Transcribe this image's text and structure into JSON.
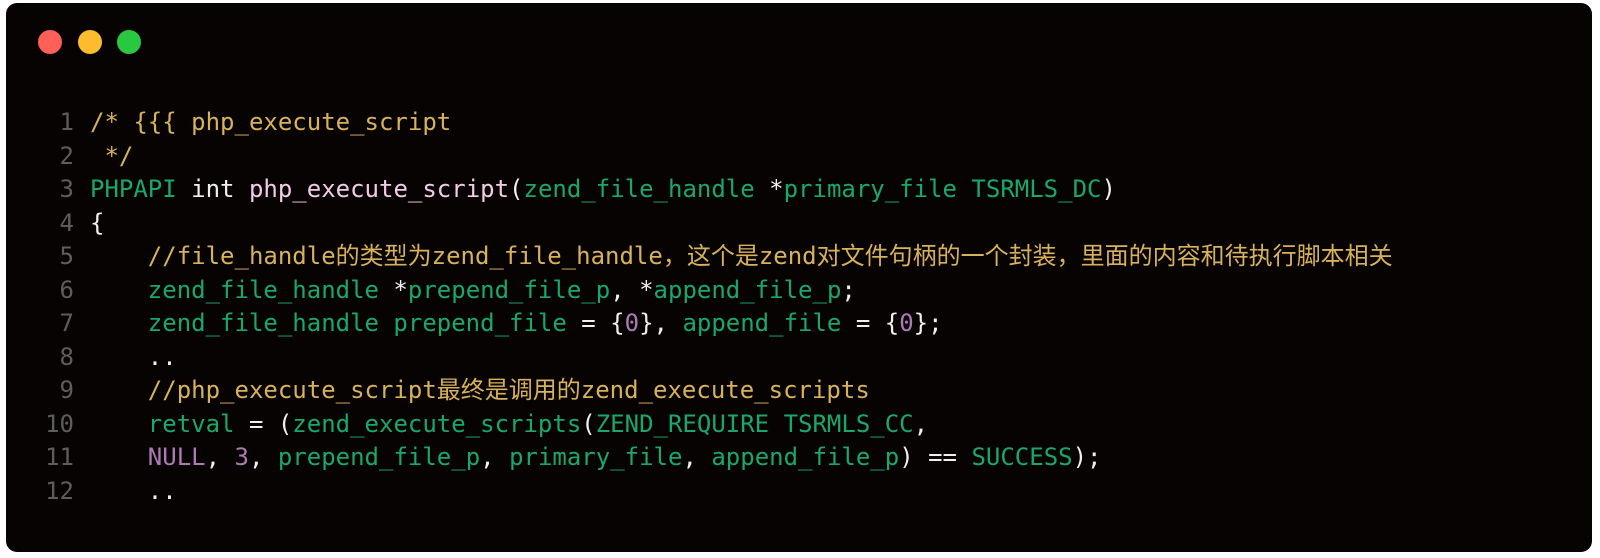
{
  "window": {
    "controls": {
      "close_color": "#fe5f57",
      "minimize_color": "#fdbc2e",
      "maximize_color": "#28c840"
    }
  },
  "colors": {
    "background": "#070303",
    "comment": "#d8b25a",
    "type": "#1aa86a",
    "plain": "#f0f0f0",
    "function": "#f2cbe6",
    "number": "#ad7ab6",
    "line_number": "#5d5d5d"
  },
  "code": {
    "lines": [
      {
        "n": "1",
        "tokens": [
          {
            "c": "comment",
            "t": "/* {{{ php_execute_script"
          }
        ]
      },
      {
        "n": "2",
        "tokens": [
          {
            "c": "comment",
            "t": " */"
          }
        ]
      },
      {
        "n": "3",
        "tokens": [
          {
            "c": "type",
            "t": "PHPAPI"
          },
          {
            "c": "plain",
            "t": " int "
          },
          {
            "c": "func",
            "t": "php_execute_script"
          },
          {
            "c": "plain",
            "t": "("
          },
          {
            "c": "type",
            "t": "zend_file_handle"
          },
          {
            "c": "plain",
            "t": " *"
          },
          {
            "c": "type",
            "t": "primary_file TSRMLS_DC"
          },
          {
            "c": "plain",
            "t": ")"
          }
        ]
      },
      {
        "n": "4",
        "tokens": [
          {
            "c": "plain",
            "t": "{"
          }
        ]
      },
      {
        "n": "5",
        "tokens": [
          {
            "c": "comment",
            "t": "    //file_handle的类型为zend_file_handle，这个是zend对文件句柄的一个封装，里面的内容和待执行脚本相关"
          }
        ]
      },
      {
        "n": "6",
        "tokens": [
          {
            "c": "plain",
            "t": "    "
          },
          {
            "c": "type",
            "t": "zend_file_handle"
          },
          {
            "c": "plain",
            "t": " *"
          },
          {
            "c": "type",
            "t": "prepend_file_p"
          },
          {
            "c": "plain",
            "t": ", *"
          },
          {
            "c": "type",
            "t": "append_file_p"
          },
          {
            "c": "plain",
            "t": ";"
          }
        ]
      },
      {
        "n": "7",
        "tokens": [
          {
            "c": "plain",
            "t": "    "
          },
          {
            "c": "type",
            "t": "zend_file_handle prepend_file"
          },
          {
            "c": "plain",
            "t": " = {"
          },
          {
            "c": "num",
            "t": "0"
          },
          {
            "c": "plain",
            "t": "}, "
          },
          {
            "c": "type",
            "t": "append_file"
          },
          {
            "c": "plain",
            "t": " = {"
          },
          {
            "c": "num",
            "t": "0"
          },
          {
            "c": "plain",
            "t": "};"
          }
        ]
      },
      {
        "n": "8",
        "tokens": [
          {
            "c": "plain",
            "t": "    .."
          }
        ]
      },
      {
        "n": "9",
        "tokens": [
          {
            "c": "comment",
            "t": "    //php_execute_script最终是调用的zend_execute_scripts"
          }
        ]
      },
      {
        "n": "10",
        "tokens": [
          {
            "c": "plain",
            "t": "    "
          },
          {
            "c": "type",
            "t": "retval"
          },
          {
            "c": "plain",
            "t": " = ("
          },
          {
            "c": "type",
            "t": "zend_execute_scripts"
          },
          {
            "c": "plain",
            "t": "("
          },
          {
            "c": "type",
            "t": "ZEND_REQUIRE TSRMLS_CC"
          },
          {
            "c": "plain",
            "t": ","
          }
        ]
      },
      {
        "n": "11",
        "tokens": [
          {
            "c": "plain",
            "t": "    "
          },
          {
            "c": "null",
            "t": "NULL"
          },
          {
            "c": "plain",
            "t": ", "
          },
          {
            "c": "num",
            "t": "3"
          },
          {
            "c": "plain",
            "t": ", "
          },
          {
            "c": "type",
            "t": "prepend_file_p"
          },
          {
            "c": "plain",
            "t": ", "
          },
          {
            "c": "type",
            "t": "primary_file"
          },
          {
            "c": "plain",
            "t": ", "
          },
          {
            "c": "type",
            "t": "append_file_p"
          },
          {
            "c": "plain",
            "t": ") == "
          },
          {
            "c": "type",
            "t": "SUCCESS"
          },
          {
            "c": "plain",
            "t": ");"
          }
        ]
      },
      {
        "n": "12",
        "tokens": [
          {
            "c": "plain",
            "t": "    .."
          }
        ]
      }
    ]
  }
}
